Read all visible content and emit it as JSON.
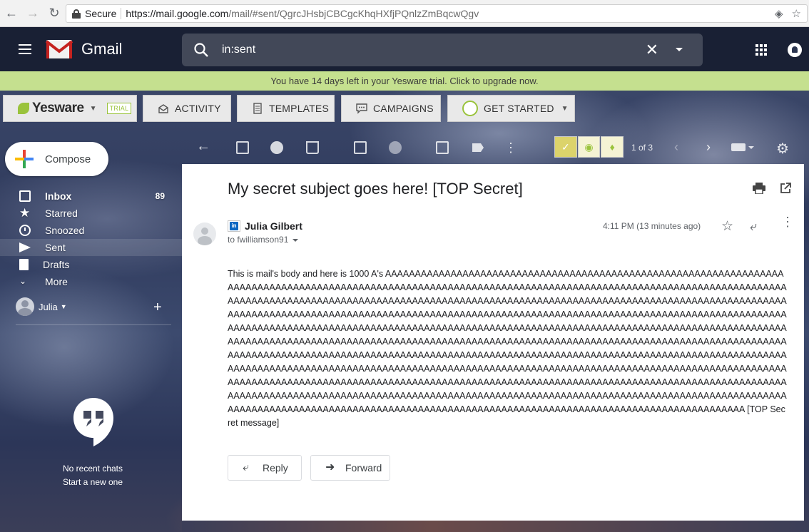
{
  "browser": {
    "secure_label": "Secure",
    "url_host": "https://mail.google.com",
    "url_path": "/mail/#sent/QgrcJHsbjCBCgcKhqHXfjPQnlzZmBqcwQgv"
  },
  "header": {
    "app_name": "Gmail",
    "search_value": "in:sent"
  },
  "trial_banner": "You have 14 days left in your Yesware trial. Click to upgrade now.",
  "yesware": {
    "brand": "Yesware",
    "trial_badge": "TRIAL",
    "buttons": {
      "activity": "ACTIVITY",
      "templates": "TEMPLATES",
      "campaigns": "CAMPAIGNS",
      "get_started": "GET STARTED"
    }
  },
  "sidebar": {
    "compose_label": "Compose",
    "items": [
      {
        "label": "Inbox",
        "count": "89",
        "icon": "inbox-icon"
      },
      {
        "label": "Starred",
        "count": "",
        "icon": "star-icon"
      },
      {
        "label": "Snoozed",
        "count": "",
        "icon": "clock-icon"
      },
      {
        "label": "Sent",
        "count": "",
        "icon": "sent-icon"
      },
      {
        "label": "Drafts",
        "count": "",
        "icon": "draft-icon"
      },
      {
        "label": "More",
        "count": "",
        "icon": "chevron-down-icon"
      }
    ],
    "user_name": "Julia",
    "no_chats": "No recent chats",
    "start_new": "Start a new one"
  },
  "toolbar": {
    "pager": "1 of 3"
  },
  "message": {
    "subject": "My secret subject goes here! [TOP Secret]",
    "sender": "Julia Gilbert",
    "to": "to fwilliamson91",
    "time": "4:11 PM (13 minutes ago)",
    "body_prefix": "This is mail's body and here is 1000 A's ",
    "body_a_count": 1000,
    "body_suffix": " [TOP Secret message]",
    "reply_label": "Reply",
    "forward_label": "Forward"
  }
}
